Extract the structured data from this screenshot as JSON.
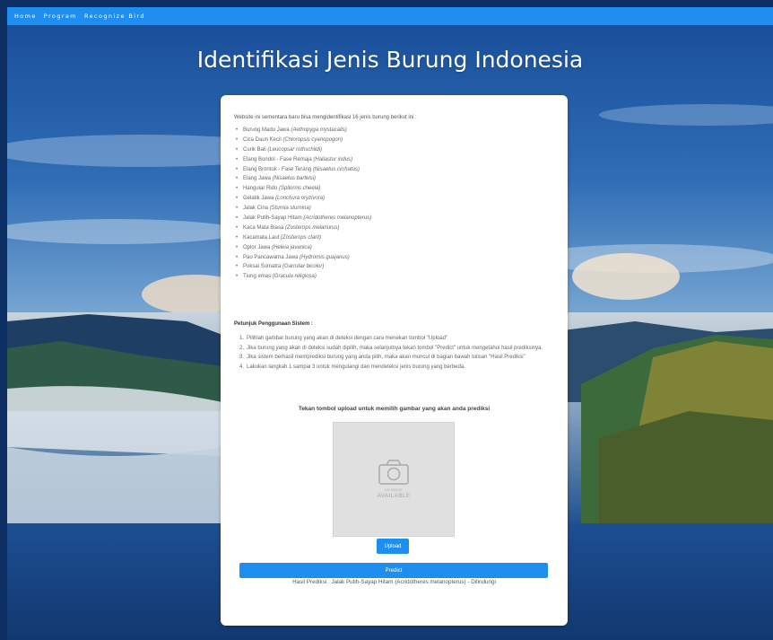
{
  "nav": {
    "items": [
      "Home",
      "Program",
      "Recognize Bird"
    ]
  },
  "page": {
    "title": "Identifikasi Jenis Burung Indonesia"
  },
  "card": {
    "intro": "Website ini sementara baru bisa mengidentifikasi 16 jenis burung berikut ini :",
    "species": [
      {
        "name": "Burung Madu Jawa",
        "sci": "(Aethopyga mystacalis)"
      },
      {
        "name": "Cica Daun Kecil",
        "sci": "(Chloropsis cyanopogon)"
      },
      {
        "name": "Curik Bali",
        "sci": "(Leucopsar rothschildi)"
      },
      {
        "name": "Elang Bondol - Fase Remaja",
        "sci": "(Haliastur indus)"
      },
      {
        "name": "Elang Brontok - Fase Terang",
        "sci": "(Nisaetus cirrhatus)"
      },
      {
        "name": "Elang Jawa",
        "sci": "(Nisaetus bartelsi)"
      },
      {
        "name": "Hanguiar Rido",
        "sci": "(Spilornis cheela)"
      },
      {
        "name": "Gelatik Jawa",
        "sci": "(Lonchura oryzivora)"
      },
      {
        "name": "Jalak Cina",
        "sci": "(Sturnia sturnina)"
      },
      {
        "name": "Jalak Putih-Sayap Hitam",
        "sci": "(Acridotheres melanopterus)"
      },
      {
        "name": "Kaca Mata Biasa",
        "sci": "(Zosterops melanurus)"
      },
      {
        "name": "Kacamata Laut",
        "sci": "(Zosterops clarit)"
      },
      {
        "name": "Oplor Jawa",
        "sci": "(Heleia javanica)"
      },
      {
        "name": "Pao Pancawarna Jawa",
        "sci": "(Hydrornis guajanus)"
      },
      {
        "name": "Poksai Sumatra",
        "sci": "(Garrulax bicolor)"
      },
      {
        "name": "Tiung emas",
        "sci": "(Gracula religiosa)"
      }
    ],
    "guide_heading": "Petunjuk Penggunaan Sistem :",
    "guide_steps": [
      {
        "num": "1.",
        "text": "Pilihlah gambar burung yang akan di deteksi dengan cara menekan tombol \"Upload\""
      },
      {
        "num": "2.",
        "text": "Jika burung yang akan di deteksi sudah dipilih, maka selanjutnya tekan tombol \"Predict\" untuk mengetahui hasil prediksinya."
      },
      {
        "num": "3.",
        "text": "Jika sistem berhasil memprediksi burung yang anda pilih, maka akan muncul di bagian bawah tulisan \"Hasil Prediksi\""
      },
      {
        "num": "4.",
        "text": "Lakukan langkah 1 sampai 3 untuk mengulangi dan mendeteksi jenis burung yang berbeda."
      }
    ],
    "upload_hint": "Tekan tombol upload untuk memilih gambar yang akan anda prediksi",
    "placeholder_small": "NO IMAGE",
    "placeholder_big": "AVAILABLE",
    "upload_label": "Upload",
    "predict_label": "Predict",
    "result": "Hasil Prediksi : Jalak Putih-Sayap Hitam (Acridotheres melanopterus) - Dilindungi"
  },
  "colors": {
    "nav": "#1e8ef0",
    "button": "#1e8ef0",
    "sky": "#1c5aa6"
  },
  "icons": {
    "placeholder": "camera-icon"
  }
}
